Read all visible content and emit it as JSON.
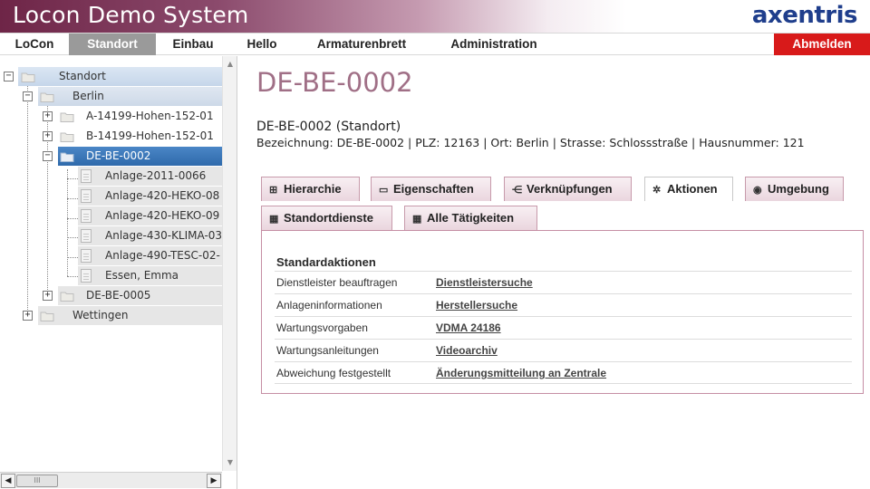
{
  "header": {
    "title": "Locon Demo System",
    "logo_text": "axentris"
  },
  "nav": {
    "items": [
      {
        "label": "LoCon"
      },
      {
        "label": "Standort"
      },
      {
        "label": "Einbau"
      },
      {
        "label": "Hello"
      },
      {
        "label": "Armaturenbrett"
      },
      {
        "label": "Administration"
      }
    ],
    "active": "Standort",
    "logout_label": "Abmelden"
  },
  "tree": {
    "items": [
      {
        "label": "Standort"
      },
      {
        "label": "Berlin"
      },
      {
        "label": "A-14199-Hohen-152-01"
      },
      {
        "label": "B-14199-Hohen-152-01"
      },
      {
        "label": "DE-BE-0002"
      },
      {
        "label": "Anlage-2011-0066"
      },
      {
        "label": "Anlage-420-HEKO-08"
      },
      {
        "label": "Anlage-420-HEKO-09"
      },
      {
        "label": "Anlage-430-KLIMA-03"
      },
      {
        "label": "Anlage-490-TESC-02-"
      },
      {
        "label": "Essen, Emma"
      },
      {
        "label": "DE-BE-0005"
      },
      {
        "label": "Wettingen"
      }
    ],
    "selected": "DE-BE-0002",
    "scroll_thumb_glyph": "III"
  },
  "main": {
    "title": "DE-BE-0002",
    "subtitle": "DE-BE-0002 (Standort)",
    "details": "Bezeichnung: DE-BE-0002 | PLZ: 12163 | Ort: Berlin | Strasse: Schlossstraße | Hausnummer: 121",
    "tabs": [
      {
        "label": "Hierarchie",
        "icon": "hierarchy-icon",
        "glyph": "⊞"
      },
      {
        "label": "Eigenschaften",
        "icon": "folder-icon",
        "glyph": "▭"
      },
      {
        "label": "Verknüpfungen",
        "icon": "link-icon",
        "glyph": "⋲"
      },
      {
        "label": "Aktionen",
        "icon": "gear-icon",
        "glyph": "✲"
      },
      {
        "label": "Umgebung",
        "icon": "target-icon",
        "glyph": "◉"
      },
      {
        "label": "Standortdienste",
        "icon": "calendar-icon",
        "glyph": "▦"
      },
      {
        "label": "Alle Tätigkeiten",
        "icon": "calendar-icon",
        "glyph": "▦"
      }
    ],
    "active_tab": "Aktionen",
    "panel": {
      "title": "Standardaktionen",
      "rows": [
        {
          "key": "Dienstleister beauftragen",
          "value": "Dienstleistersuche"
        },
        {
          "key": "Anlageninformationen",
          "value": "Herstellersuche"
        },
        {
          "key": "Wartungsvorgaben",
          "value": "VDMA 24186"
        },
        {
          "key": "Wartungsanleitungen",
          "value": "Videoarchiv"
        },
        {
          "key": "Abweichung festgestellt",
          "value": "Änderungsmitteilung an Zentrale"
        }
      ]
    }
  },
  "colors": {
    "accent": "#a06f86",
    "logout": "#d81a1a",
    "selected": "#3573b5",
    "logo": "#1f3e8c"
  }
}
